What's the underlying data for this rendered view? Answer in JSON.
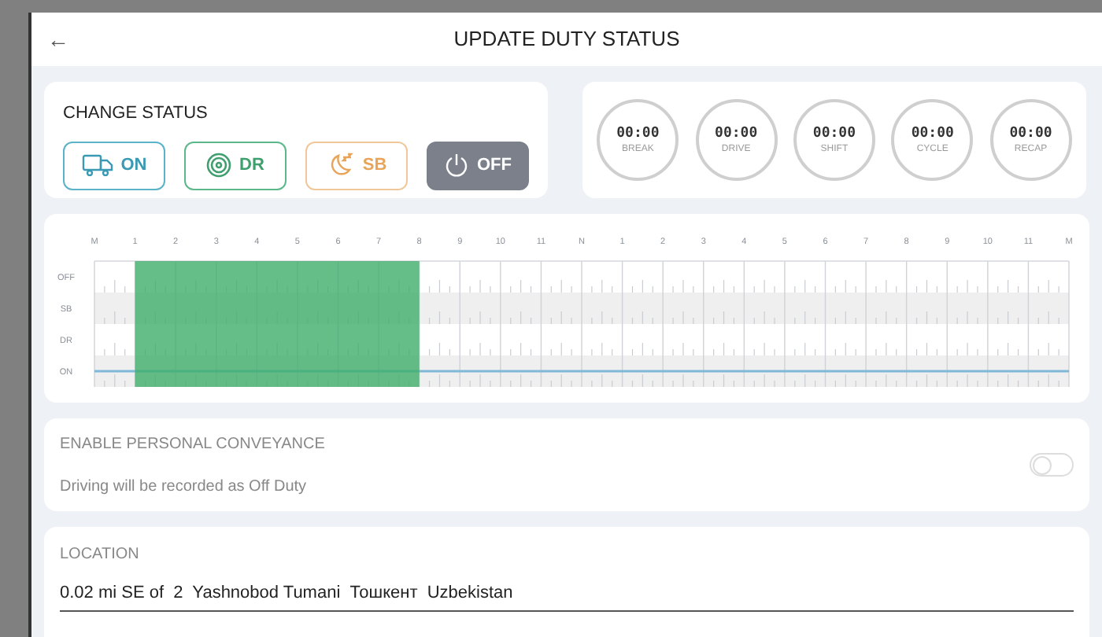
{
  "header": {
    "back": "←",
    "title": "UPDATE DUTY STATUS"
  },
  "change_status": {
    "title": "CHANGE STATUS",
    "buttons": [
      {
        "kind": "on",
        "label": "ON",
        "selected": false
      },
      {
        "kind": "dr",
        "label": "DR",
        "selected": false
      },
      {
        "kind": "sb",
        "label": "SB",
        "selected": false
      },
      {
        "kind": "off",
        "label": "OFF",
        "selected": true
      }
    ]
  },
  "timers": [
    {
      "time": "00:00",
      "label": "BREAK"
    },
    {
      "time": "00:00",
      "label": "DRIVE"
    },
    {
      "time": "00:00",
      "label": "SHIFT"
    },
    {
      "time": "00:00",
      "label": "CYCLE"
    },
    {
      "time": "00:00",
      "label": "RECAP"
    }
  ],
  "log_graph": {
    "hour_labels": [
      "M",
      "1",
      "2",
      "3",
      "4",
      "5",
      "6",
      "7",
      "8",
      "9",
      "10",
      "11",
      "N",
      "1",
      "2",
      "3",
      "4",
      "5",
      "6",
      "7",
      "8",
      "9",
      "10",
      "11",
      "M"
    ],
    "status_labels": [
      "OFF",
      "SB",
      "DR",
      "ON"
    ]
  },
  "personal_conveyance": {
    "title": "ENABLE PERSONAL CONVEYANCE",
    "description": "Driving will be recorded as Off Duty",
    "on": false
  },
  "location": {
    "label": "LOCATION",
    "value": "0.02 mi SE of  2  Yashnobod Tumani  Тошкент  Uzbekistan"
  }
}
